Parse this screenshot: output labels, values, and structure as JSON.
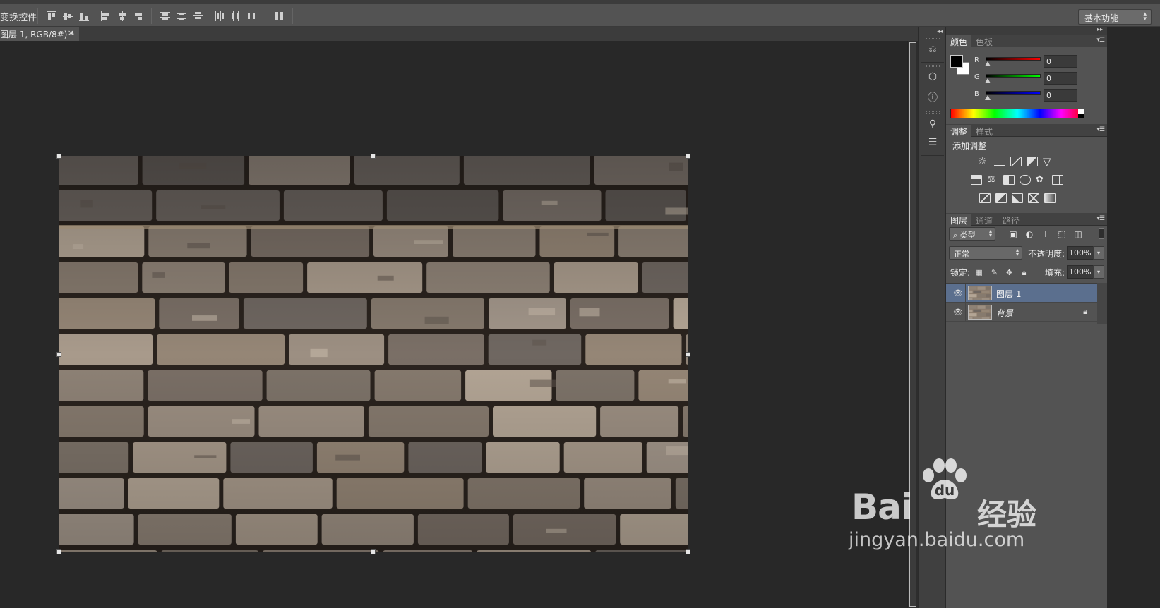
{
  "options_bar": {
    "transform_label": "变换控件",
    "workspace": "基本功能"
  },
  "document": {
    "tab_title": "图层 1, RGB/8#) *",
    "close": "×"
  },
  "color_panel": {
    "tabs": [
      "颜色",
      "色板"
    ],
    "channels": [
      {
        "label": "R",
        "value": "0",
        "color": "#ff0000"
      },
      {
        "label": "G",
        "value": "0",
        "color": "#00ff00"
      },
      {
        "label": "B",
        "value": "0",
        "color": "#0000ff"
      }
    ],
    "foreground": "#000000",
    "background": "#ffffff"
  },
  "adjust_panel": {
    "tabs": [
      "调整",
      "样式"
    ],
    "title": "添加调整"
  },
  "layers_panel": {
    "tabs": [
      "图层",
      "通道",
      "路径"
    ],
    "filter": "类型",
    "blend_mode": "正常",
    "opacity_label": "不透明度:",
    "opacity": "100%",
    "lock_label": "锁定:",
    "fill_label": "填充:",
    "fill": "100%",
    "layers": [
      {
        "name": "图层 1",
        "selected": true,
        "locked": false
      },
      {
        "name": "背景",
        "selected": false,
        "locked": true
      }
    ]
  },
  "watermark": {
    "brand_left": "Bai",
    "brand_right": "经验",
    "url": "jingyan.baidu.com"
  }
}
